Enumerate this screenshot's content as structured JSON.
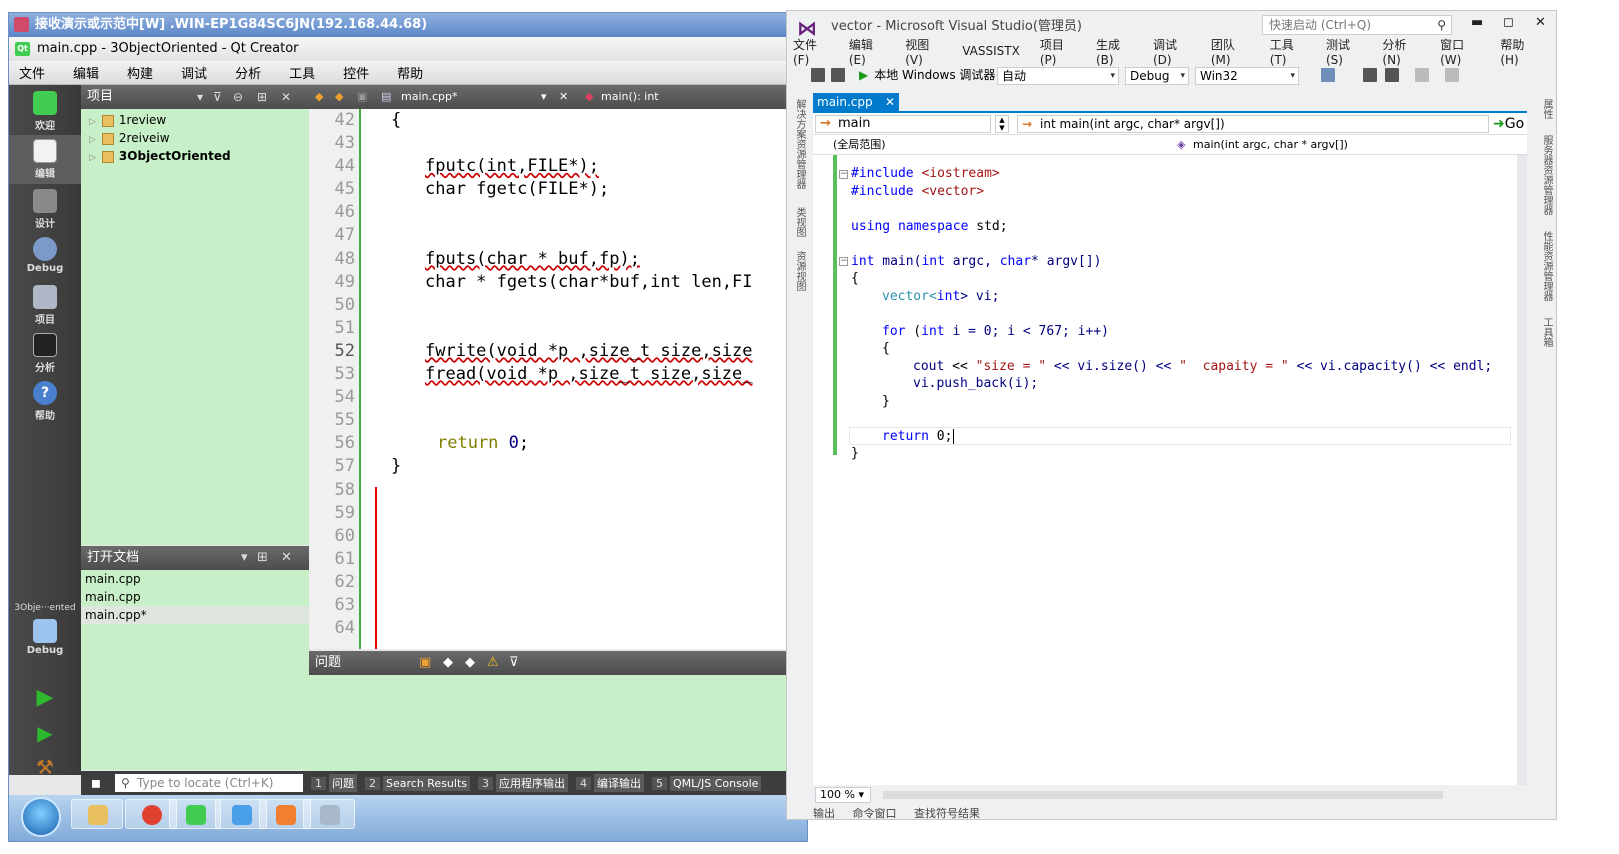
{
  "remote": {
    "title": "接收演示或示范中[W] .WIN-EP1G84SC6JN(192.168.44.68)"
  },
  "qt": {
    "title": "main.cpp - 3ObjectOriented - Qt Creator",
    "menu": [
      "文件",
      "编辑",
      "构建",
      "调试",
      "分析",
      "工具",
      "控件",
      "帮助"
    ],
    "modes": [
      "欢迎",
      "编辑",
      "设计",
      "Debug",
      "项目",
      "分析",
      "帮助"
    ],
    "kit_project": "3Obje···ented",
    "kit_mode": "Debug",
    "project_pane_title": "项目",
    "projects": [
      "1review",
      "2reiveiw",
      "3ObjectOriented"
    ],
    "open_docs_title": "打开文档",
    "open_docs": [
      "main.cpp",
      "main.cpp",
      "main.cpp*"
    ],
    "editor_file": "main.cpp*",
    "editor_symbol": "main(): int",
    "line_numbers": [
      "42",
      "43",
      "44",
      "45",
      "46",
      "47",
      "48",
      "49",
      "50",
      "51",
      "52",
      "53",
      "54",
      "55",
      "56",
      "57",
      "58",
      "59",
      "60",
      "61",
      "62",
      "63",
      "64"
    ],
    "code": {
      "l42": "{",
      "l44": "fputc(int,FILE*);",
      "l45": "char fgetc(FILE*);",
      "l48": "fputs(char * buf,fp);",
      "l49": "char * fgets(char*buf,int len,FI",
      "l52": "fwrite(void *p ,size_t size,size",
      "l53": "fread(void *p ,size_t size,size_",
      "l56a": "return",
      "l56b": "0",
      "l56c": ";",
      "l57": "}"
    },
    "issues_title": "问题",
    "locate_placeholder": "Type to locate (Ctrl+K)",
    "output_tabs": [
      {
        "num": "1",
        "label": "问题"
      },
      {
        "num": "2",
        "label": "Search Results"
      },
      {
        "num": "3",
        "label": "应用程序输出"
      },
      {
        "num": "4",
        "label": "编译输出"
      },
      {
        "num": "5",
        "label": "QML/JS Console"
      }
    ]
  },
  "vs": {
    "title": "vector - Microsoft Visual Studio(管理员)",
    "quick_launch": "快速启动 (Ctrl+Q)",
    "menu": [
      "文件(F)",
      "编辑(E)",
      "视图(V)",
      "VASSISTX",
      "项目(P)",
      "生成(B)",
      "调试(D)",
      "团队(M)",
      "工具(T)",
      "测试(S)",
      "分析(N)",
      "窗口(W)",
      "帮助(H)"
    ],
    "run_target": "本地 Windows 调试器",
    "run_mode": "自动",
    "config": "Debug",
    "platform": "Win32",
    "left_strip": [
      "解决方案资源管理器",
      "类视图",
      "资源视图"
    ],
    "right_strip": [
      "属性",
      "服务器资源管理器",
      "性能资源管理器",
      "工具箱"
    ],
    "tab": "main.cpp",
    "nav_scope": "main",
    "nav_func": "int main(int argc, char* argv[])",
    "go_label": "Go",
    "scope_global": "(全局范围)",
    "scope_member": "main(int argc, char * argv[])",
    "code": {
      "inc1a": "#include",
      "inc1b": " <iostream>",
      "inc2a": "#include",
      "inc2b": " <vector>",
      "using_kw1": "using",
      "using_kw2": "namespace",
      "using_rest": " std;",
      "main_kw": "int",
      "main_fn": " main(",
      "main_kw2": "int",
      "main_p1": " argc, ",
      "main_kw3": "char",
      "main_p2": "* argv[])",
      "brace_open": "{",
      "vec_type": "vector<",
      "vec_kw": "int",
      "vec_rest": "> vi;",
      "for_kw": "for",
      "for_p1": " (",
      "for_kw2": "int",
      "for_rest": " i = 0; i < 767; i++)",
      "inner_open": "{",
      "cout_id": "cout",
      "cout_op1": " << ",
      "cout_s1": "\"size = \"",
      "cout_op2": " << vi.size() << ",
      "cout_s2": "\"  capaity = \"",
      "cout_op3": " << vi.capacity() << endl;",
      "push": "vi.push_back(i);",
      "inner_close": "}",
      "return_kw": "return",
      "return_rest": " 0;",
      "brace_close": "}"
    },
    "zoom": "100 %",
    "output_tabs": [
      "输出",
      "命令窗口",
      "查找符号结果"
    ]
  }
}
